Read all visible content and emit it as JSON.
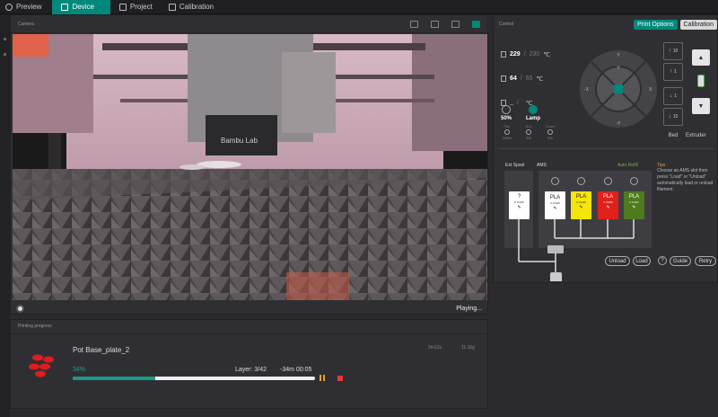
{
  "tabs": [
    {
      "label": "Preview",
      "icon": "gear-icon"
    },
    {
      "label": "Device",
      "icon": "printer-icon",
      "active": true
    },
    {
      "label": "Project",
      "icon": "project-icon"
    },
    {
      "label": "Calibration",
      "icon": "calibration-icon"
    }
  ],
  "camera": {
    "title": "Camera",
    "status": "Playing...",
    "printer_logo": "Bambu Lab"
  },
  "progress": {
    "title": "Printing progress",
    "file_name": "Pot Base_plate_2",
    "percent": "34%",
    "percent_value": 34,
    "layer": "Layer: 3/42",
    "remaining": "-34m 00:05",
    "time": "2m12s",
    "weight": "11.16g"
  },
  "control": {
    "title": "Control",
    "print_options_label": "Print Options",
    "calibration_label": "Calibration",
    "nozzle_temp": "229",
    "nozzle_target": "230",
    "bed_temp": "64",
    "bed_target": "65",
    "chamber_temp": "_",
    "chamber_target": "",
    "temp_unit": "℃",
    "speed": "50%",
    "lamp_label": "Lamp",
    "fans": [
      {
        "label": "Part",
        "value": "100%"
      },
      {
        "label": "Aux",
        "value": "0%"
      },
      {
        "label": "Cham",
        "value": "0%"
      }
    ],
    "jog_labels": {
      "up": "Y",
      "down": "-Y",
      "left": "-X",
      "right": "X"
    },
    "bed_buttons": [
      "10",
      "1",
      "1",
      "10"
    ],
    "bed_label": "Bed",
    "extruder_label": "Extruder"
  },
  "ams": {
    "ext_spool_label": "Ext Spool",
    "ams_label": "AMS",
    "auto_refill_label": "Auto Refill",
    "ext_spool": {
      "material": "?",
      "k": "K 0.000"
    },
    "slots": [
      {
        "material": "PLA",
        "k": "K 0.020",
        "color": "#ffffff",
        "text_color": "#222222"
      },
      {
        "material": "PLA",
        "k": "K 0.020",
        "color": "#f5e50a",
        "text_color": "#222222"
      },
      {
        "material": "PLA",
        "k": "K 0.020",
        "color": "#e0201b",
        "text_color": "#ffffff"
      },
      {
        "material": "PLA",
        "k": "K 0.020",
        "color": "#4e7b1e",
        "text_color": "#ffffff"
      }
    ],
    "tips_title": "Tips",
    "tips_body": "Choose an AMS slot then press \"Load\" or \"Unload\" automatically load or unload filament.",
    "unload_label": "Unload",
    "load_label": "Load",
    "guide_label": "Guide",
    "retry_label": "Retry"
  }
}
